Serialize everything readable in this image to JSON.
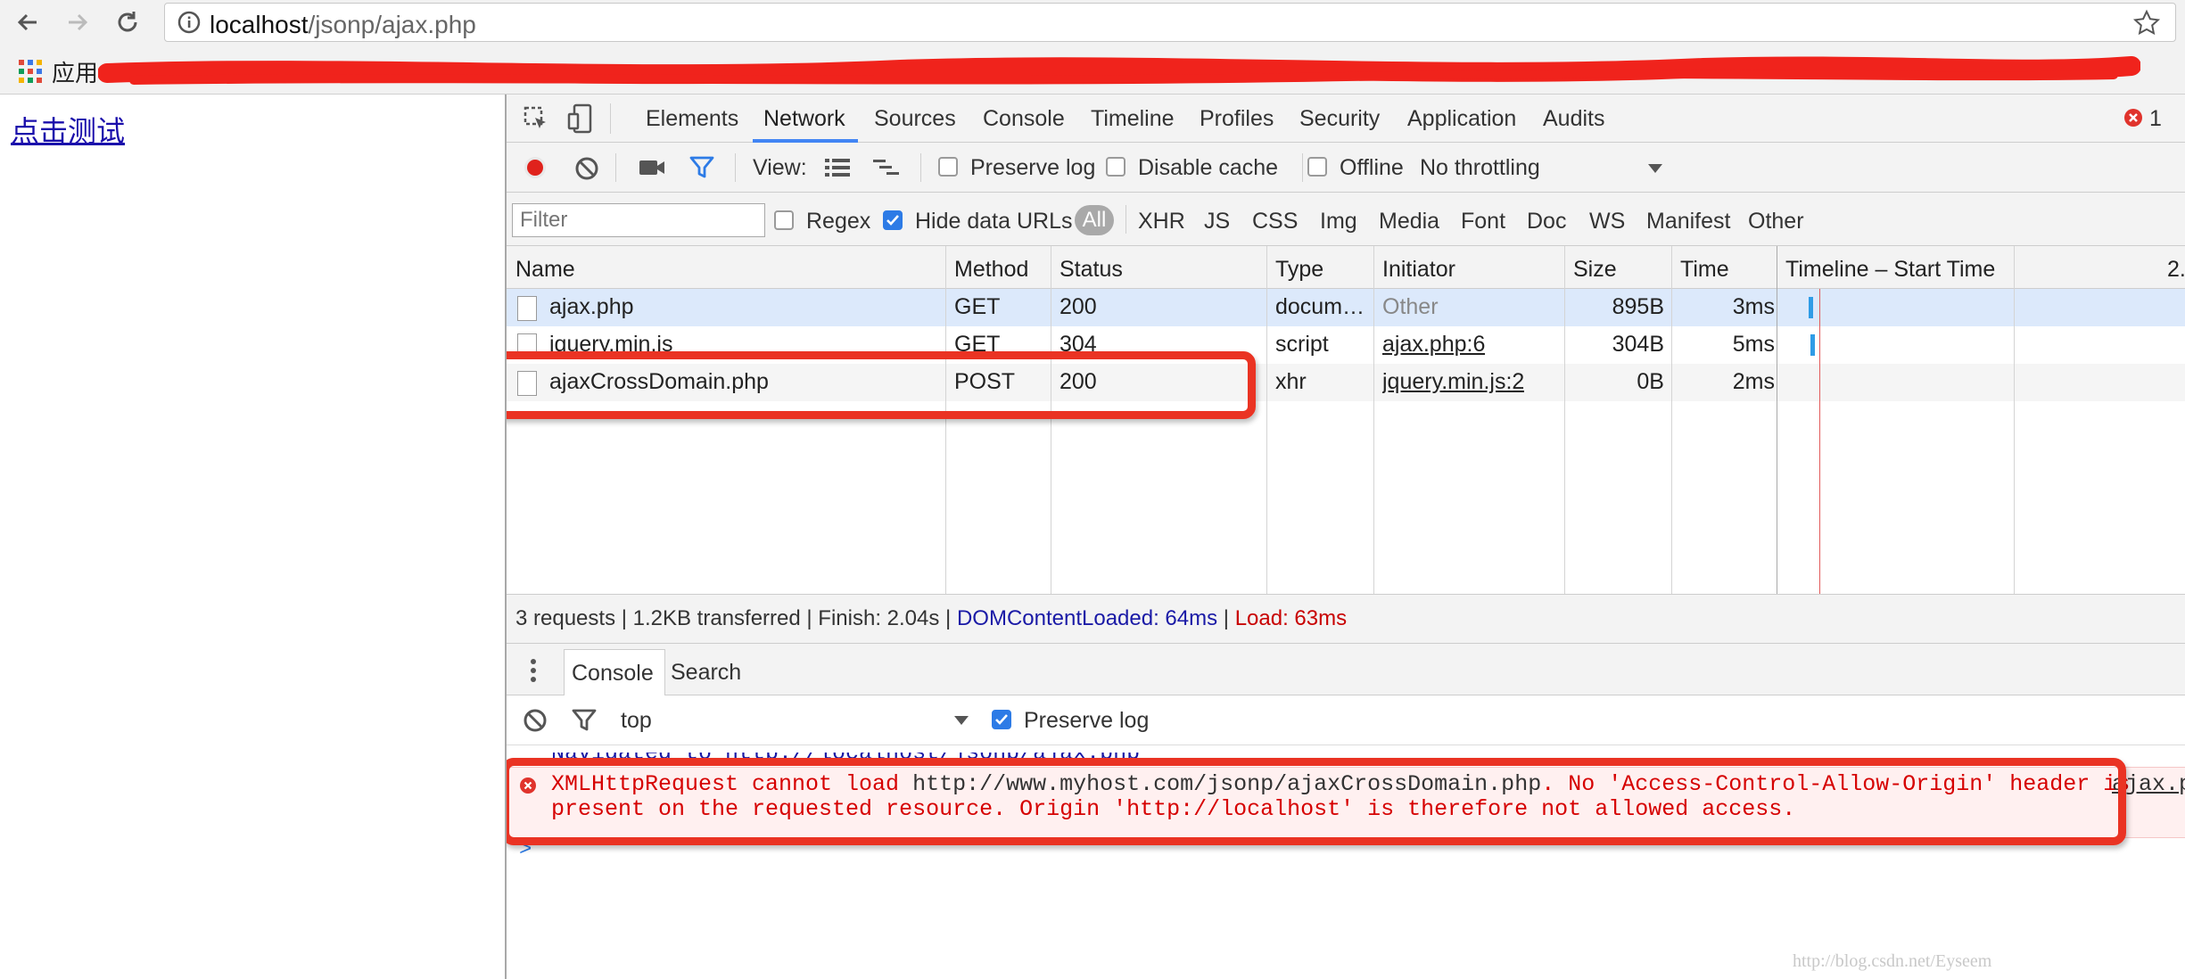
{
  "browser": {
    "url_host": "localhost",
    "url_path": "/jsonp/ajax.php",
    "bookmarks_apps_label": "应用"
  },
  "page": {
    "test_link": "点击测试"
  },
  "devtools": {
    "tabs": [
      "Elements",
      "Network",
      "Sources",
      "Console",
      "Timeline",
      "Profiles",
      "Security",
      "Application",
      "Audits"
    ],
    "active_tab": "Network",
    "error_count": "1",
    "toolbar": {
      "view_label": "View:",
      "preserve_log": "Preserve log",
      "disable_cache": "Disable cache",
      "offline": "Offline",
      "throttling": "No throttling"
    },
    "filter": {
      "placeholder": "Filter",
      "regex": "Regex",
      "hide_data_urls": "Hide data URLs",
      "types": [
        "All",
        "XHR",
        "JS",
        "CSS",
        "Img",
        "Media",
        "Font",
        "Doc",
        "WS",
        "Manifest",
        "Other"
      ]
    },
    "table": {
      "headers": [
        "Name",
        "Method",
        "Status",
        "Type",
        "Initiator",
        "Size",
        "Time",
        "Timeline – Start Time"
      ],
      "header_overflow": "2.",
      "rows": [
        {
          "name": "ajax.php",
          "method": "GET",
          "status": "200",
          "type": "docum…",
          "initiator": "Other",
          "size": "895B",
          "time": "3ms"
        },
        {
          "name": "jquery.min.js",
          "method": "GET",
          "status": "304",
          "type": "script",
          "initiator": "ajax.php:6",
          "size": "304B",
          "time": "5ms"
        },
        {
          "name": "ajaxCrossDomain.php",
          "method": "POST",
          "status": "200",
          "type": "xhr",
          "initiator": "jquery.min.js:2",
          "size": "0B",
          "time": "2ms"
        }
      ]
    },
    "status_bar": {
      "summary": "3 requests | 1.2KB transferred | Finish: 2.04s | ",
      "dom_content_loaded": "DOMContentLoaded: 64ms",
      "separator": " | ",
      "load": "Load: 63ms"
    },
    "drawer": {
      "tabs": [
        "Console",
        "Search"
      ],
      "context": "top",
      "preserve_log": "Preserve log"
    },
    "console": {
      "navigated_text": "Navigated to http://localhost/jsonp/ajax.php",
      "error_line1_a": "XMLHttpRequest cannot load ",
      "error_url": "http://www.myhost.com/jsonp/ajaxCrossDomain.php",
      "error_line1_b": ". No 'Access-Control-Allow-Origin' header is",
      "error_line2": "present on the requested resource. Origin 'http://localhost' is therefore not allowed access.",
      "error_source": "ajax.p",
      "prompt": ">"
    }
  },
  "watermark": "http://blog.csdn.net/Eyseem",
  "colors": {
    "accent_blue": "#4285f4",
    "error_red": "#d60000",
    "annotation_red": "#ea3323"
  }
}
